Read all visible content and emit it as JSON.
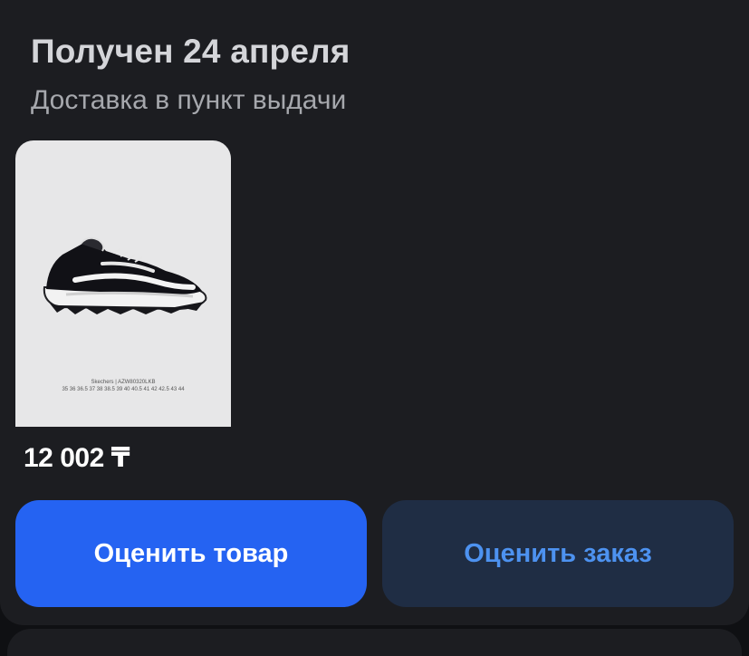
{
  "order": {
    "title": "Получен 24 апреля",
    "subtitle": "Доставка в пункт выдачи"
  },
  "product": {
    "image_icon": "sneaker-icon",
    "brand_line": "Skechers | AZW80320LKB",
    "sizes_line": "35 36 36.5 37 38 38.5 39 40 40.5 41 42 42.5 43 44",
    "price": "12 002 ₸"
  },
  "actions": {
    "rate_product_label": "Оценить товар",
    "rate_order_label": "Оценить заказ"
  },
  "colors": {
    "card_background": "#1c1d21",
    "primary_button": "#2563f2",
    "secondary_button": "#1f2d44",
    "secondary_button_text": "#4d92f0"
  }
}
